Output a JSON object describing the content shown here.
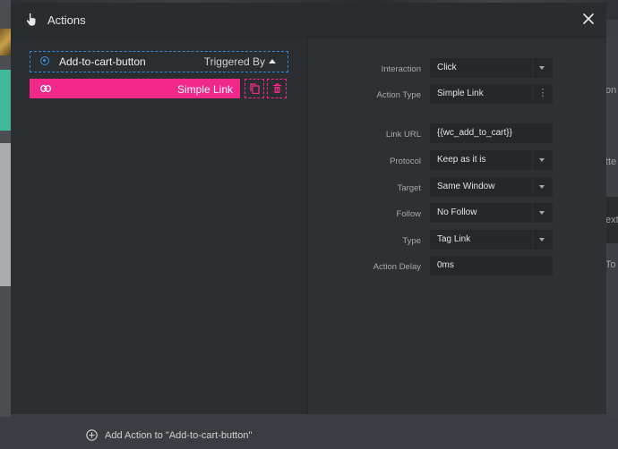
{
  "modal": {
    "title": "Actions",
    "close_icon": "close-icon",
    "header_icon": "hand-pointer-icon"
  },
  "trigger": {
    "name": "Add-to-cart-button",
    "triggered_by_label": "Triggered By"
  },
  "action_item": {
    "label": "Simple Link",
    "icon": "link-icon",
    "copy_icon": "copy-icon",
    "delete_icon": "trash-icon"
  },
  "footer": {
    "add_label": "Add Action to \"Add-to-cart-button\"",
    "icon": "plus-circle-icon"
  },
  "properties": {
    "interaction": {
      "label": "Interaction",
      "value": "Click"
    },
    "action_type": {
      "label": "Action Type",
      "value": "Simple Link"
    },
    "link_url": {
      "label": "Link URL",
      "value": "{{wc_add_to_cart}}"
    },
    "protocol": {
      "label": "Protocol",
      "value": "Keep as it is"
    },
    "target": {
      "label": "Target",
      "value": "Same Window"
    },
    "follow": {
      "label": "Follow",
      "value": "No Follow"
    },
    "type": {
      "label": "Type",
      "value": "Tag Link"
    },
    "action_delay": {
      "label": "Action Delay",
      "value": "0ms"
    }
  },
  "background": {
    "right_texts": [
      "on",
      "tte",
      "ext/",
      "To"
    ]
  },
  "colors": {
    "accent_pink": "#f1278a",
    "accent_blue": "#2e8bd8",
    "panel": "#2d3033"
  }
}
